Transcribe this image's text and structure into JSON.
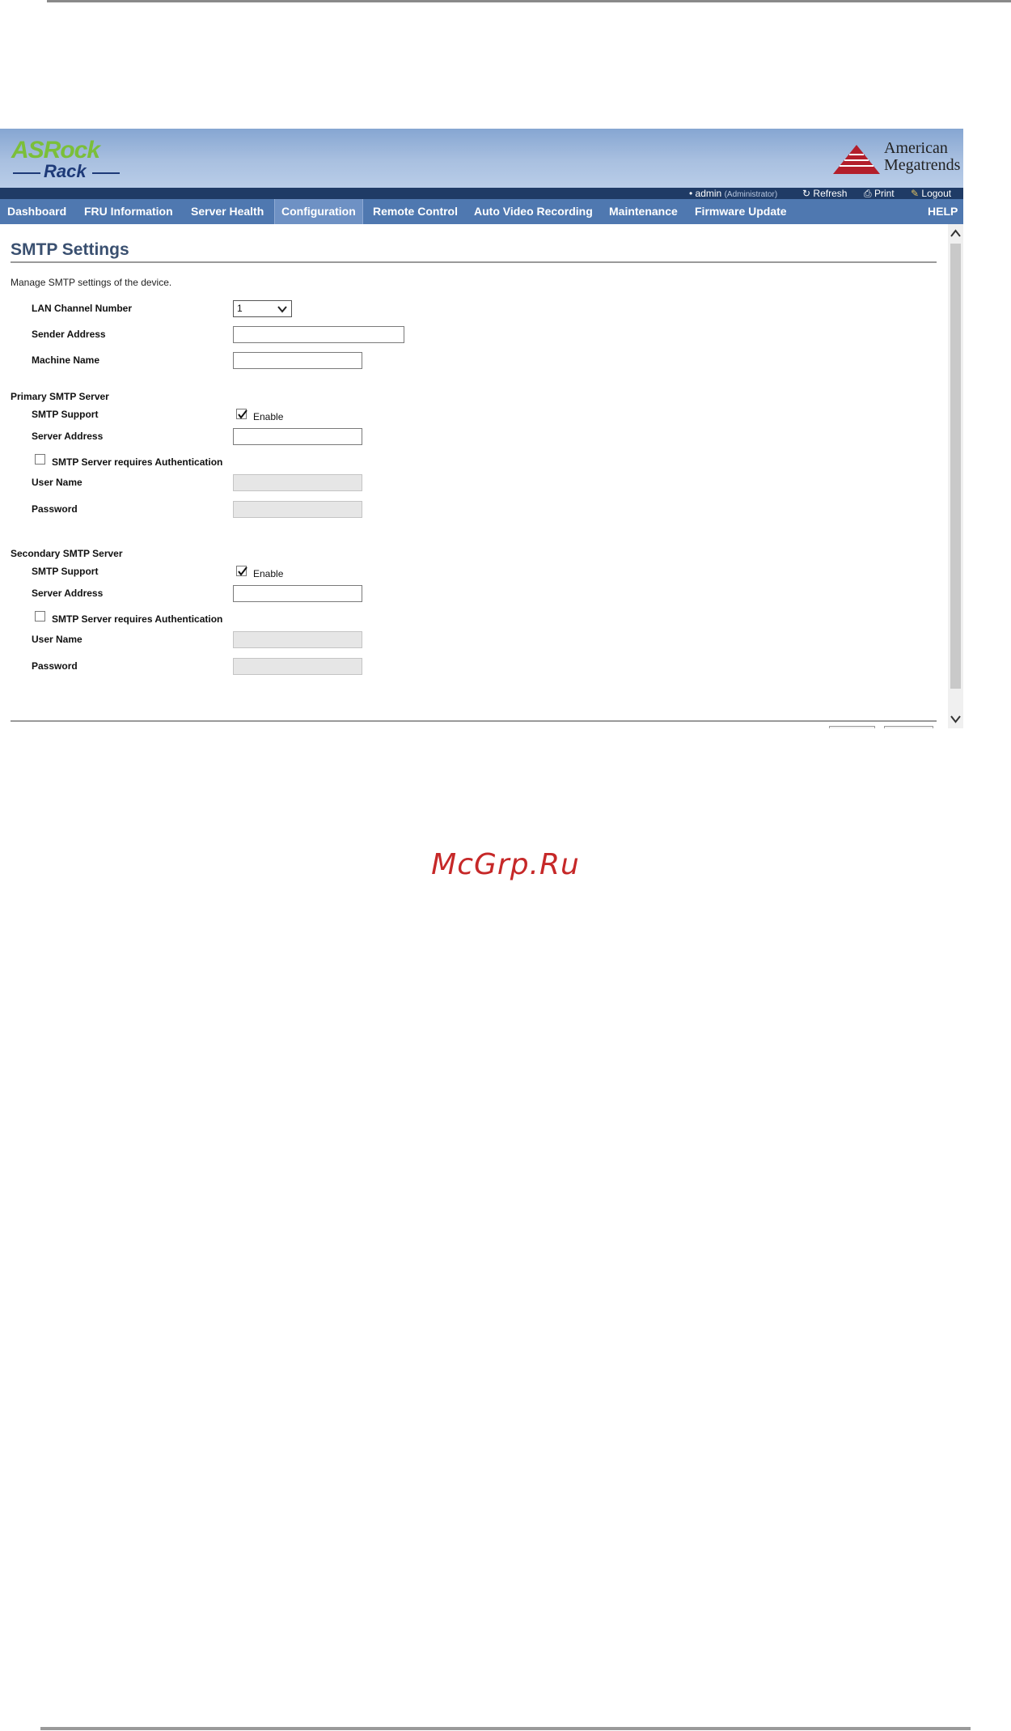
{
  "header": {
    "brand_top": "ASRock",
    "brand_bottom": "Rack",
    "vendor_line1": "American",
    "vendor_line2": "Megatrends"
  },
  "status_bar": {
    "user": "admin",
    "role": "(Administrator)",
    "refresh": "Refresh",
    "print": "Print",
    "logout": "Logout"
  },
  "nav": {
    "items": [
      {
        "label": "Dashboard"
      },
      {
        "label": "FRU Information"
      },
      {
        "label": "Server Health"
      },
      {
        "label": "Configuration"
      },
      {
        "label": "Remote Control"
      },
      {
        "label": "Auto Video Recording"
      },
      {
        "label": "Maintenance"
      },
      {
        "label": "Firmware Update"
      }
    ],
    "active": "Configuration",
    "help": "HELP"
  },
  "page": {
    "title": "SMTP Settings",
    "description": "Manage SMTP settings of the device."
  },
  "general": {
    "lan_channel_label": "LAN Channel Number",
    "lan_channel_value": "1",
    "sender_address_label": "Sender Address",
    "sender_address_value": "",
    "machine_name_label": "Machine Name",
    "machine_name_value": ""
  },
  "primary": {
    "section_label": "Primary SMTP Server",
    "smtp_support_label": "SMTP Support",
    "smtp_support_checked": true,
    "enable_label": "Enable",
    "server_address_label": "Server Address",
    "server_address_value": "",
    "auth_label": "SMTP Server requires Authentication",
    "auth_checked": false,
    "user_name_label": "User Name",
    "password_label": "Password"
  },
  "secondary": {
    "section_label": "Secondary SMTP Server",
    "smtp_support_label": "SMTP Support",
    "smtp_support_checked": true,
    "enable_label": "Enable",
    "server_address_label": "Server Address",
    "server_address_value": "",
    "auth_label": "SMTP Server requires Authentication",
    "auth_checked": false,
    "user_name_label": "User Name",
    "password_label": "Password"
  },
  "watermark": "McGrp.Ru",
  "colors": {
    "nav_bg": "#4f78b0",
    "nav_active": "#6e91c4",
    "status_bg": "#1f3b66",
    "title": "#3a5070",
    "watermark": "#c62828"
  }
}
